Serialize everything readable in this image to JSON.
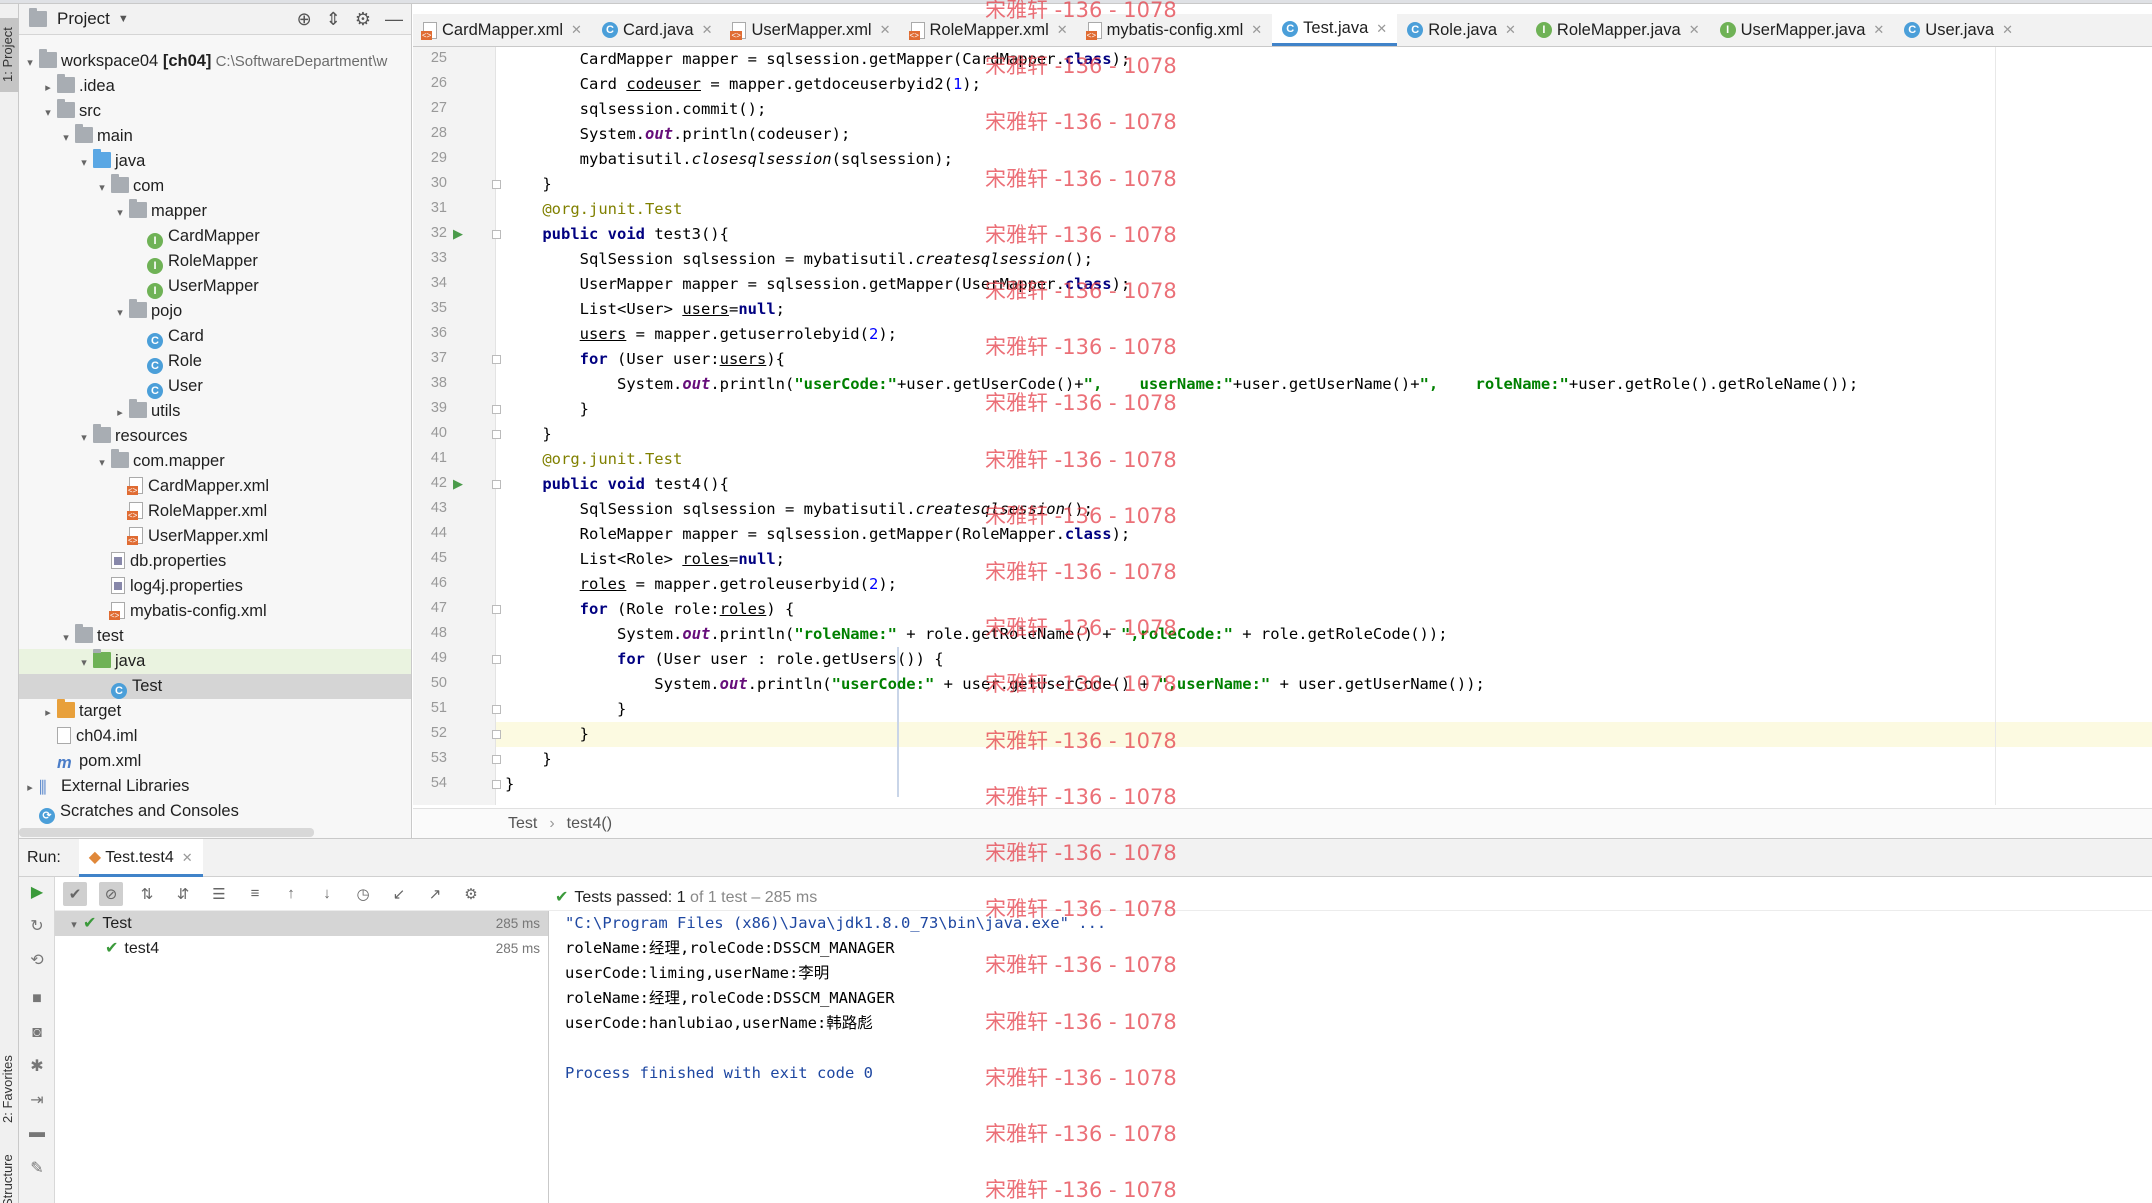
{
  "project_panel": {
    "title": "Project",
    "tree": [
      {
        "indent": 0,
        "tw": "▾",
        "icon": "folder",
        "label": "workspace04",
        "bold_suffix": " [ch04]",
        "muted": "  C:\\SoftwareDepartment\\w"
      },
      {
        "indent": 1,
        "tw": "▸",
        "icon": "folder",
        "label": ".idea"
      },
      {
        "indent": 1,
        "tw": "▾",
        "icon": "folder",
        "label": "src"
      },
      {
        "indent": 2,
        "tw": "▾",
        "icon": "folder",
        "label": "main"
      },
      {
        "indent": 3,
        "tw": "▾",
        "icon": "folder-blue",
        "label": "java"
      },
      {
        "indent": 4,
        "tw": "▾",
        "icon": "folder",
        "label": "com"
      },
      {
        "indent": 5,
        "tw": "▾",
        "icon": "folder",
        "label": "mapper"
      },
      {
        "indent": 6,
        "tw": "",
        "icon": "interface",
        "label": "CardMapper"
      },
      {
        "indent": 6,
        "tw": "",
        "icon": "interface",
        "label": "RoleMapper"
      },
      {
        "indent": 6,
        "tw": "",
        "icon": "interface",
        "label": "UserMapper"
      },
      {
        "indent": 5,
        "tw": "▾",
        "icon": "folder",
        "label": "pojo"
      },
      {
        "indent": 6,
        "tw": "",
        "icon": "class",
        "label": "Card"
      },
      {
        "indent": 6,
        "tw": "",
        "icon": "class",
        "label": "Role"
      },
      {
        "indent": 6,
        "tw": "",
        "icon": "class",
        "label": "User"
      },
      {
        "indent": 5,
        "tw": "▸",
        "icon": "folder",
        "label": "utils"
      },
      {
        "indent": 3,
        "tw": "▾",
        "icon": "folder",
        "label": "resources"
      },
      {
        "indent": 4,
        "tw": "▾",
        "icon": "folder",
        "label": "com.mapper"
      },
      {
        "indent": 5,
        "tw": "",
        "icon": "xml",
        "label": "CardMapper.xml"
      },
      {
        "indent": 5,
        "tw": "",
        "icon": "xml",
        "label": "RoleMapper.xml"
      },
      {
        "indent": 5,
        "tw": "",
        "icon": "xml",
        "label": "UserMapper.xml"
      },
      {
        "indent": 4,
        "tw": "",
        "icon": "prop",
        "label": "db.properties"
      },
      {
        "indent": 4,
        "tw": "",
        "icon": "prop",
        "label": "log4j.properties"
      },
      {
        "indent": 4,
        "tw": "",
        "icon": "xml",
        "label": "mybatis-config.xml"
      },
      {
        "indent": 2,
        "tw": "▾",
        "icon": "folder",
        "label": "test"
      },
      {
        "indent": 3,
        "tw": "▾",
        "icon": "folder-green",
        "label": "java",
        "state": "sel-light"
      },
      {
        "indent": 4,
        "tw": "",
        "icon": "class",
        "label": "Test",
        "state": "sel"
      },
      {
        "indent": 1,
        "tw": "▸",
        "icon": "folder-orange",
        "label": "target"
      },
      {
        "indent": 1,
        "tw": "",
        "icon": "file",
        "label": "ch04.iml"
      },
      {
        "indent": 1,
        "tw": "",
        "icon": "maven",
        "label": "pom.xml"
      },
      {
        "indent": 0,
        "tw": "▸",
        "icon": "libs",
        "label": "External Libraries"
      },
      {
        "indent": 0,
        "tw": "",
        "icon": "scratch",
        "label": "Scratches and Consoles"
      }
    ]
  },
  "side_tabs": {
    "project": "1: Project",
    "favorites": "2: Favorites",
    "structure": "Structure"
  },
  "tabs": [
    {
      "label": "CardMapper.xml",
      "icon": "xml"
    },
    {
      "label": "Card.java",
      "icon": "class"
    },
    {
      "label": "UserMapper.xml",
      "icon": "xml"
    },
    {
      "label": "RoleMapper.xml",
      "icon": "xml"
    },
    {
      "label": "mybatis-config.xml",
      "icon": "xml"
    },
    {
      "label": "Test.java",
      "icon": "class",
      "active": true
    },
    {
      "label": "Role.java",
      "icon": "class"
    },
    {
      "label": "RoleMapper.java",
      "icon": "interface"
    },
    {
      "label": "UserMapper.java",
      "icon": "interface"
    },
    {
      "label": "User.java",
      "icon": "class"
    }
  ],
  "editor": {
    "lines": [
      {
        "n": 25,
        "code": "        CardMapper mapper = sqlsession.getMapper(CardMapper.<kw>class</kw>);"
      },
      {
        "n": 26,
        "code": "        Card <ul>codeuser</ul> = mapper.getdoceuserbyid2(<n>1</n>);"
      },
      {
        "n": 27,
        "code": "        sqlsession.commit();"
      },
      {
        "n": 28,
        "code": "        System.<fld>out</fld>.println(codeuser);"
      },
      {
        "n": 29,
        "code": "        mybatisutil.<it>closesqlsession</it>(sqlsession);"
      },
      {
        "n": 30,
        "code": "    }"
      },
      {
        "n": 31,
        "code": "    <ann>@org.junit.Test</ann>"
      },
      {
        "n": 32,
        "code": "    <kw>public void</kw> test3(){",
        "run": true
      },
      {
        "n": 33,
        "code": "        SqlSession sqlsession = mybatisutil.<it>createsqlsession</it>();"
      },
      {
        "n": 34,
        "code": "        UserMapper mapper = sqlsession.getMapper(UserMapper.<kw>class</kw>);"
      },
      {
        "n": 35,
        "code": "        List&lt;User&gt; <ul>users</ul>=<kw>null</kw>;"
      },
      {
        "n": 36,
        "code": "        <ul>users</ul> = mapper.getuserrolebyid(<n>2</n>);"
      },
      {
        "n": 37,
        "code": "        <kw>for</kw> (User user:<ul>users</ul>){"
      },
      {
        "n": 38,
        "code": "            System.<fld>out</fld>.println(<str>\"userCode:\"</str>+user.getUserCode()+<str>\",    userName:\"</str>+user.getUserName()+<str>\",    roleName:\"</str>+user.getRole().getRoleName());"
      },
      {
        "n": 39,
        "code": "        }"
      },
      {
        "n": 40,
        "code": "    }"
      },
      {
        "n": 41,
        "code": "    <ann>@org.junit.Test</ann>"
      },
      {
        "n": 42,
        "code": "    <kw>public void</kw> test4(){",
        "run": true
      },
      {
        "n": 43,
        "code": "        SqlSession sqlsession = mybatisutil.<it>createsqlsession</it>();"
      },
      {
        "n": 44,
        "code": "        RoleMapper mapper = sqlsession.getMapper(RoleMapper.<kw>class</kw>);"
      },
      {
        "n": 45,
        "code": "        List&lt;Role&gt; <ul>roles</ul>=<kw>null</kw>;"
      },
      {
        "n": 46,
        "code": "        <ul>roles</ul> = mapper.getroleuserbyid(<n>2</n>);"
      },
      {
        "n": 47,
        "code": "        <kw>for</kw> (Role role:<ul>roles</ul>) {"
      },
      {
        "n": 48,
        "code": "            System.<fld>out</fld>.println(<str>\"roleName:\"</str> + role.getRoleName() + <str>\",roleCode:\"</str> + role.getRoleCode());"
      },
      {
        "n": 49,
        "code": "            <kw>for</kw> (User user : role.getUsers()) {"
      },
      {
        "n": 50,
        "code": "                System.<fld>out</fld>.println(<str>\"userCode:\"</str> + user.getUserCode() + <str>\",userName:\"</str> + user.getUserName());"
      },
      {
        "n": 51,
        "code": "            }"
      },
      {
        "n": 52,
        "code": "        }",
        "current": true
      },
      {
        "n": 53,
        "code": "    }"
      },
      {
        "n": 54,
        "code": "}"
      }
    ]
  },
  "breadcrumb": {
    "class": "Test",
    "method": "test4()"
  },
  "run": {
    "label": "Run:",
    "tab": "Test.test4",
    "status_prefix": "Tests passed: ",
    "status_count": "1",
    "status_suffix": " of 1 test – 285 ms",
    "tests": [
      {
        "label": "Test",
        "time": "285 ms",
        "indent": 0,
        "sel": true
      },
      {
        "label": "test4",
        "time": "285 ms",
        "indent": 1
      }
    ],
    "console": [
      {
        "text": "\"C:\\Program Files (x86)\\Java\\jdk1.8.0_73\\bin\\java.exe\" ...",
        "kind": "cmd"
      },
      {
        "text": "roleName:经理,roleCode:DSSCM_MANAGER",
        "kind": "out"
      },
      {
        "text": "userCode:liming,userName:李明",
        "kind": "out"
      },
      {
        "text": "roleName:经理,roleCode:DSSCM_MANAGER",
        "kind": "out"
      },
      {
        "text": "userCode:hanlubiao,userName:韩路彪",
        "kind": "out"
      },
      {
        "text": "",
        "kind": "out"
      },
      {
        "text": "Process finished with exit code 0",
        "kind": "fin"
      }
    ]
  },
  "watermark": "宋雅轩 -136 - 1078"
}
